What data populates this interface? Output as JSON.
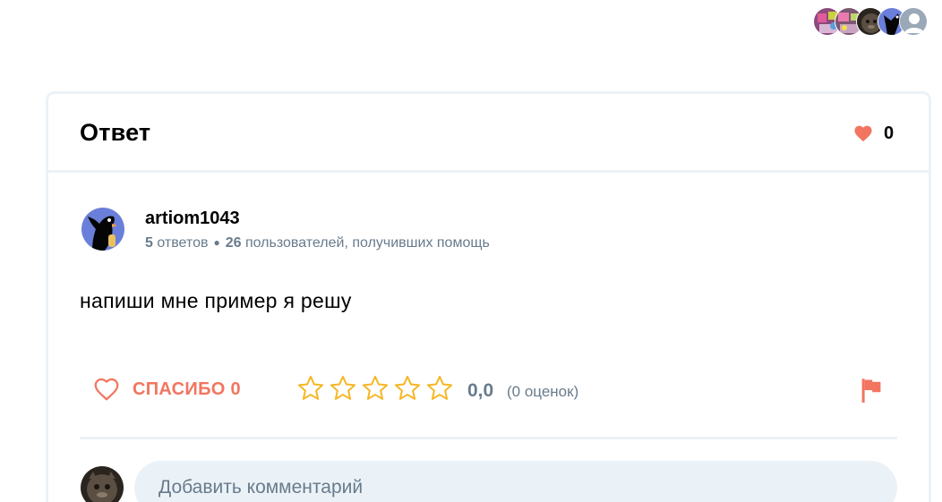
{
  "header": {
    "avatars": [
      "user-avatar-1",
      "user-avatar-2",
      "user-avatar-3",
      "user-avatar-4",
      "default-user-avatar"
    ]
  },
  "answer": {
    "title": "Ответ",
    "likes": "0",
    "author": {
      "name": "artiom1043",
      "answers_count": "5",
      "answers_label": "ответов",
      "helped_count": "26",
      "helped_label": "пользователей, получивших помощь"
    },
    "text": "напиши мне пример я решу",
    "thanks_label": "СПАСИБО 0",
    "rating": {
      "value": "0,0",
      "count_label": "(0 оценок)",
      "stars_filled": 0,
      "stars_total": 5
    }
  },
  "comment": {
    "placeholder": "Добавить комментарий"
  },
  "colors": {
    "accent": "#f27560",
    "star": "#f5b725",
    "muted": "#687b8c",
    "border": "#ebf2f7"
  },
  "icons": {
    "like": "heart-icon",
    "thanks": "heart-outline-icon",
    "rating": "star-icon",
    "report": "flag-icon"
  }
}
